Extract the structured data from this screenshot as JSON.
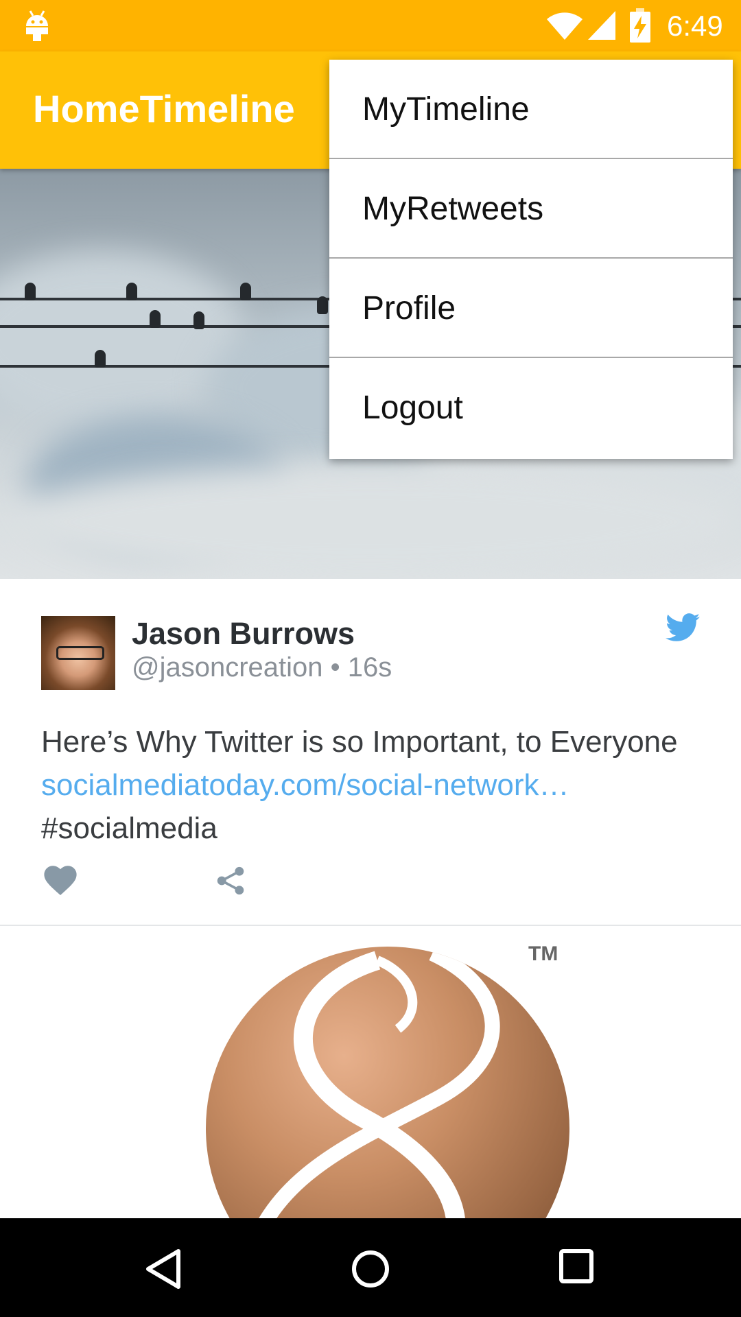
{
  "status_bar": {
    "time": "6:49",
    "icons": [
      "android-icon",
      "wifi-icon",
      "signal-icon",
      "battery-charging-icon"
    ],
    "color": "#FFB300"
  },
  "app_bar": {
    "title": "HomeTimeline",
    "color": "#FFC107"
  },
  "overflow_menu": {
    "items": [
      {
        "label": "MyTimeline"
      },
      {
        "label": "MyRetweets"
      },
      {
        "label": "Profile"
      },
      {
        "label": "Logout"
      }
    ]
  },
  "tweet": {
    "name": "Jason Burrows",
    "handle": "@jasoncreation",
    "separator": " • ",
    "age": "16s",
    "text_before": "Here’s Why Twitter is so Important, to Everyone ",
    "link": "socialmediatoday.com/social-network…",
    "text_after": " #socialmedia",
    "link_color": "#55acee",
    "icons": [
      "heart-icon",
      "share-icon",
      "twitter-bird-icon"
    ]
  },
  "logo": {
    "tm": "TM"
  },
  "nav_bar": {
    "icons": [
      "back-icon",
      "home-icon",
      "recents-icon"
    ]
  }
}
